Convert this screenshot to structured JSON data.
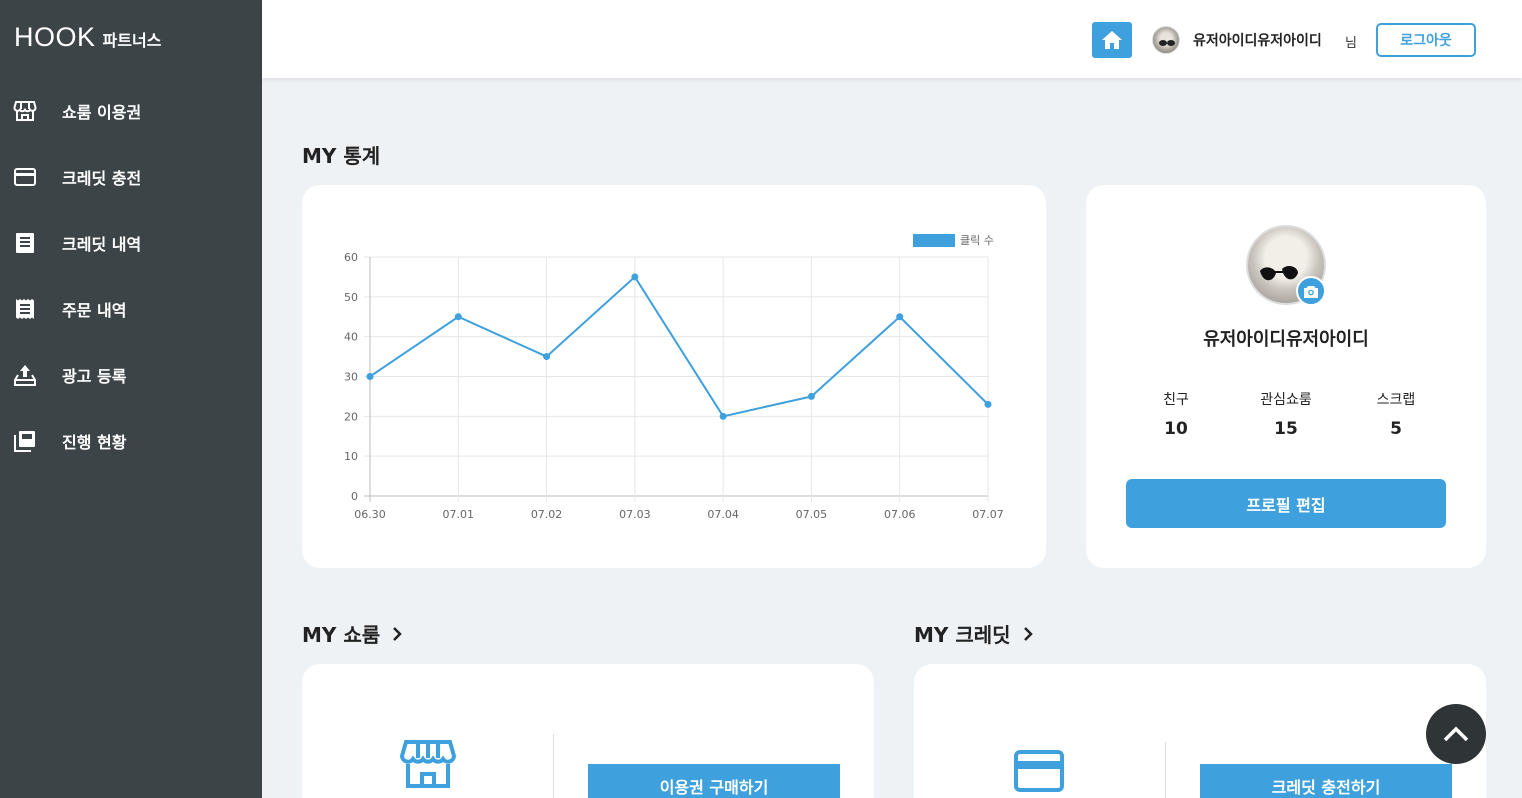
{
  "brand": {
    "logo": "HOOK",
    "sub": "파트너스"
  },
  "sidebar": {
    "items": [
      {
        "label": "쇼룸 이용권",
        "icon": "store-icon"
      },
      {
        "label": "크레딧 충전",
        "icon": "credit-card-icon"
      },
      {
        "label": "크레딧 내역",
        "icon": "list-icon"
      },
      {
        "label": "주문 내역",
        "icon": "receipt-icon"
      },
      {
        "label": "광고 등록",
        "icon": "upload-icon"
      },
      {
        "label": "진행 현황",
        "icon": "library-icon"
      }
    ]
  },
  "header": {
    "username": "유저아이디유저아이디",
    "suffix": "님",
    "logout_label": "로그아웃"
  },
  "stats_section": {
    "title": "MY 통계"
  },
  "chart_data": {
    "type": "line",
    "categories": [
      "06.30",
      "07.01",
      "07.02",
      "07.03",
      "07.04",
      "07.05",
      "07.06",
      "07.07"
    ],
    "series": [
      {
        "name": "클릭 수",
        "values": [
          30,
          45,
          35,
          55,
          20,
          25,
          45,
          23
        ]
      }
    ],
    "ylim": [
      0,
      60
    ],
    "yticks": [
      0,
      10,
      20,
      30,
      40,
      50,
      60
    ],
    "grid": true,
    "legend": "top-right",
    "color": "#3ea0dc"
  },
  "profile": {
    "name": "유저아이디유저아이디",
    "stats": [
      {
        "label": "친구",
        "value": "10"
      },
      {
        "label": "관심쇼룸",
        "value": "15"
      },
      {
        "label": "스크랩",
        "value": "5"
      }
    ],
    "edit_label": "프로필 편집"
  },
  "showroom_section": {
    "title": "MY 쇼룸",
    "button_label": "이용권 구매하기"
  },
  "credit_section": {
    "title": "MY 크레딧",
    "button_label": "크레딧 충전하기"
  },
  "colors": {
    "accent": "#3ea0dc",
    "sidebar": "#3d4448",
    "background": "#eff2f5"
  }
}
